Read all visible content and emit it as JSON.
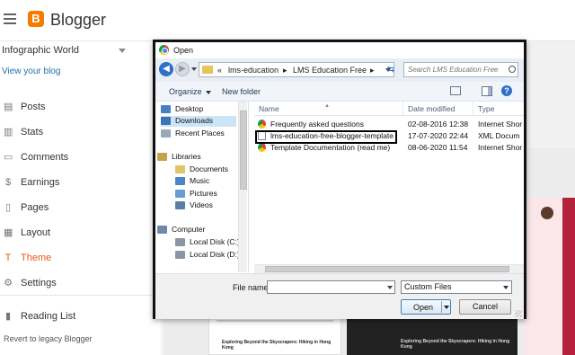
{
  "app": {
    "title": "Blogger",
    "logo_letter": "B"
  },
  "sidebar": {
    "blog_name": "Infographic World",
    "view_blog": "View your blog",
    "items": [
      {
        "label": "Posts",
        "icon": "posts-icon",
        "glyph": "▤"
      },
      {
        "label": "Stats",
        "icon": "stats-icon",
        "glyph": "▥"
      },
      {
        "label": "Comments",
        "icon": "comments-icon",
        "glyph": "▭"
      },
      {
        "label": "Earnings",
        "icon": "earnings-icon",
        "glyph": "$"
      },
      {
        "label": "Pages",
        "icon": "pages-icon",
        "glyph": "▯"
      },
      {
        "label": "Layout",
        "icon": "layout-icon",
        "glyph": "▦"
      },
      {
        "label": "Theme",
        "icon": "theme-icon",
        "glyph": "T"
      },
      {
        "label": "Settings",
        "icon": "gear-icon",
        "glyph": "⚙"
      }
    ],
    "reading_list": {
      "label": "Reading List",
      "icon": "bookmark-icon",
      "glyph": "▮"
    },
    "revert": "Revert to legacy Blogger",
    "active_item": "Theme",
    "active_color": "#e7581b"
  },
  "background_thumbs": {
    "post_title_1": "Exploring Beyond the Skyscrapers: Hiking in Hong Kong",
    "post_title_2": "Exploring Beyond the Skyscrapers: Hiking in Hong Kong"
  },
  "dialog": {
    "title": "Open",
    "breadcrumb": [
      "«",
      "lms-education",
      "▸",
      "LMS Education Free",
      "▸"
    ],
    "search_placeholder": "Search LMS Education Free",
    "toolbar": {
      "organize": "Organize",
      "new_folder": "New folder"
    },
    "nav_pane": {
      "favorites": [
        {
          "label": "Desktop",
          "icon": "desktop-icon",
          "color": "#4a7fc1"
        },
        {
          "label": "Downloads",
          "icon": "downloads-icon",
          "color": "#3d73b8"
        },
        {
          "label": "Recent Places",
          "icon": "recent-places-icon",
          "color": "#9aa7b5"
        }
      ],
      "libraries_header": "Libraries",
      "libraries": [
        {
          "label": "Documents",
          "icon": "documents-icon",
          "color": "#e0c36a"
        },
        {
          "label": "Music",
          "icon": "music-icon",
          "color": "#4d86c6"
        },
        {
          "label": "Pictures",
          "icon": "pictures-icon",
          "color": "#6c9bd1"
        },
        {
          "label": "Videos",
          "icon": "videos-icon",
          "color": "#5a7ea8"
        }
      ],
      "computer_header": "Computer",
      "drives": [
        {
          "label": "Local Disk (C:)",
          "icon": "disk-icon",
          "color": "#8a96a3"
        },
        {
          "label": "Local Disk (D:)",
          "icon": "disk-icon",
          "color": "#8a96a3"
        }
      ]
    },
    "columns": [
      "Name",
      "Date modified",
      "Type"
    ],
    "files": [
      {
        "name": "Frequently asked questions",
        "date": "02-08-2016 12:38",
        "type": "Internet Shor",
        "icon": "chrome-file-icon"
      },
      {
        "name": "lms-education-free-blogger-template",
        "date": "17-07-2020 22:44",
        "type": "XML Docum",
        "icon": "xml-file-icon"
      },
      {
        "name": "Template Documentation (read me)",
        "date": "08-06-2020 11:54",
        "type": "Internet Shor",
        "icon": "chrome-file-icon"
      }
    ],
    "file_name_label": "File name:",
    "file_name_value": "",
    "filter_value": "Custom Files",
    "open_label": "Open",
    "cancel_label": "Cancel"
  }
}
